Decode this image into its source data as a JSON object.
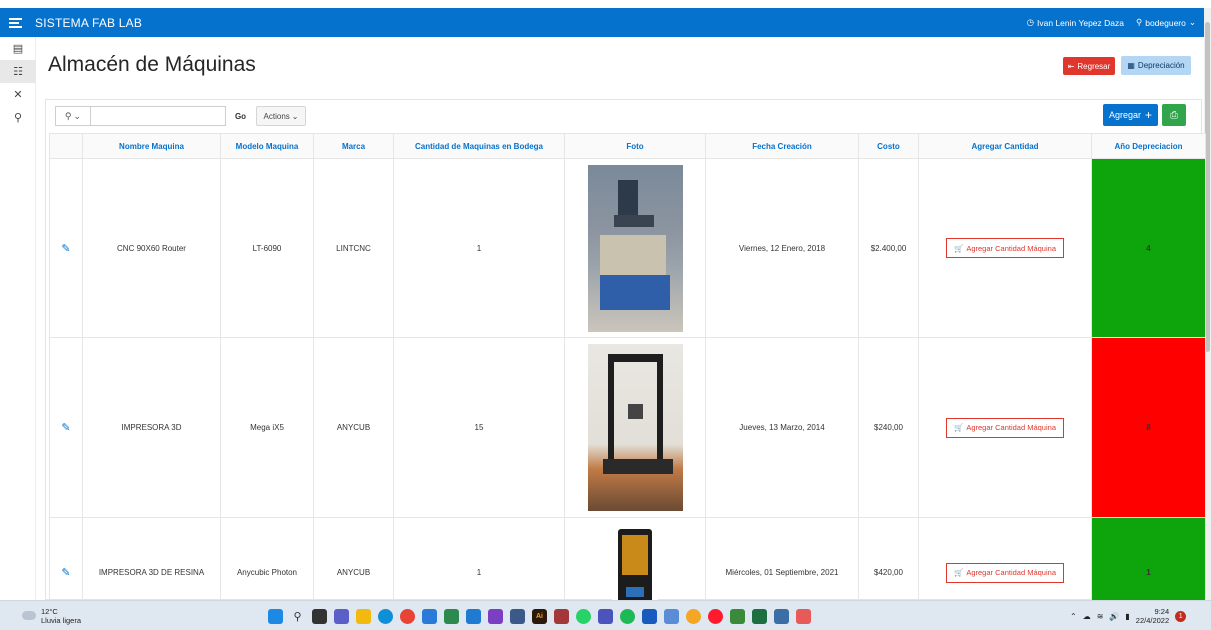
{
  "header": {
    "app_title": "SISTEMA FAB LAB",
    "user_name": "Ivan Lenin Yepez Daza",
    "role": "bodeguero"
  },
  "page": {
    "title": "Almacén de Máquinas",
    "back_label": "Regresar",
    "depreciation_label": "Depreciación"
  },
  "toolbar": {
    "search_value": "",
    "go_label": "Go",
    "actions_label": "Actions",
    "add_label": "Agregar"
  },
  "table": {
    "columns": [
      "Nombre Maquina",
      "Modelo Maquina",
      "Marca",
      "Cantidad de Maquinas en Bodega",
      "Foto",
      "Fecha Creación",
      "Costo",
      "Agregar Cantidad",
      "Año Depreciacion"
    ],
    "rows": [
      {
        "nombre": "CNC 90X60 Router",
        "modelo": "LT-6090",
        "marca": "LINTCNC",
        "cantidad": "1",
        "fecha": "Viernes, 12 Enero, 2018",
        "costo": "$2.400,00",
        "agregar": "Agregar Cantidad Máquina",
        "anio": "4",
        "status_color": "#0ea40b"
      },
      {
        "nombre": "IMPRESORA 3D",
        "modelo": "Mega iX5",
        "marca": "ANYCUB",
        "cantidad": "15",
        "fecha": "Jueves, 13 Marzo, 2014",
        "costo": "$240,00",
        "agregar": "Agregar Cantidad Máquina",
        "anio": "8",
        "status_color": "#fe0000"
      },
      {
        "nombre": "IMPRESORA 3D DE RESINA",
        "modelo": "Anycubic Photon",
        "marca": "ANYCUB",
        "cantidad": "1",
        "fecha": "Miércoles, 01 Septiembre, 2021",
        "costo": "$420,00",
        "agregar": "Agregar Cantidad Máquina",
        "anio": "1",
        "status_color": "#0ea40b"
      }
    ]
  },
  "taskbar": {
    "temperature": "12°C",
    "weather": "Lluvia ligera",
    "time": "9:24",
    "date": "22/4/2022"
  },
  "colors": {
    "brand": "#0572ce",
    "danger": "#e0362c",
    "success": "#30a54b"
  }
}
